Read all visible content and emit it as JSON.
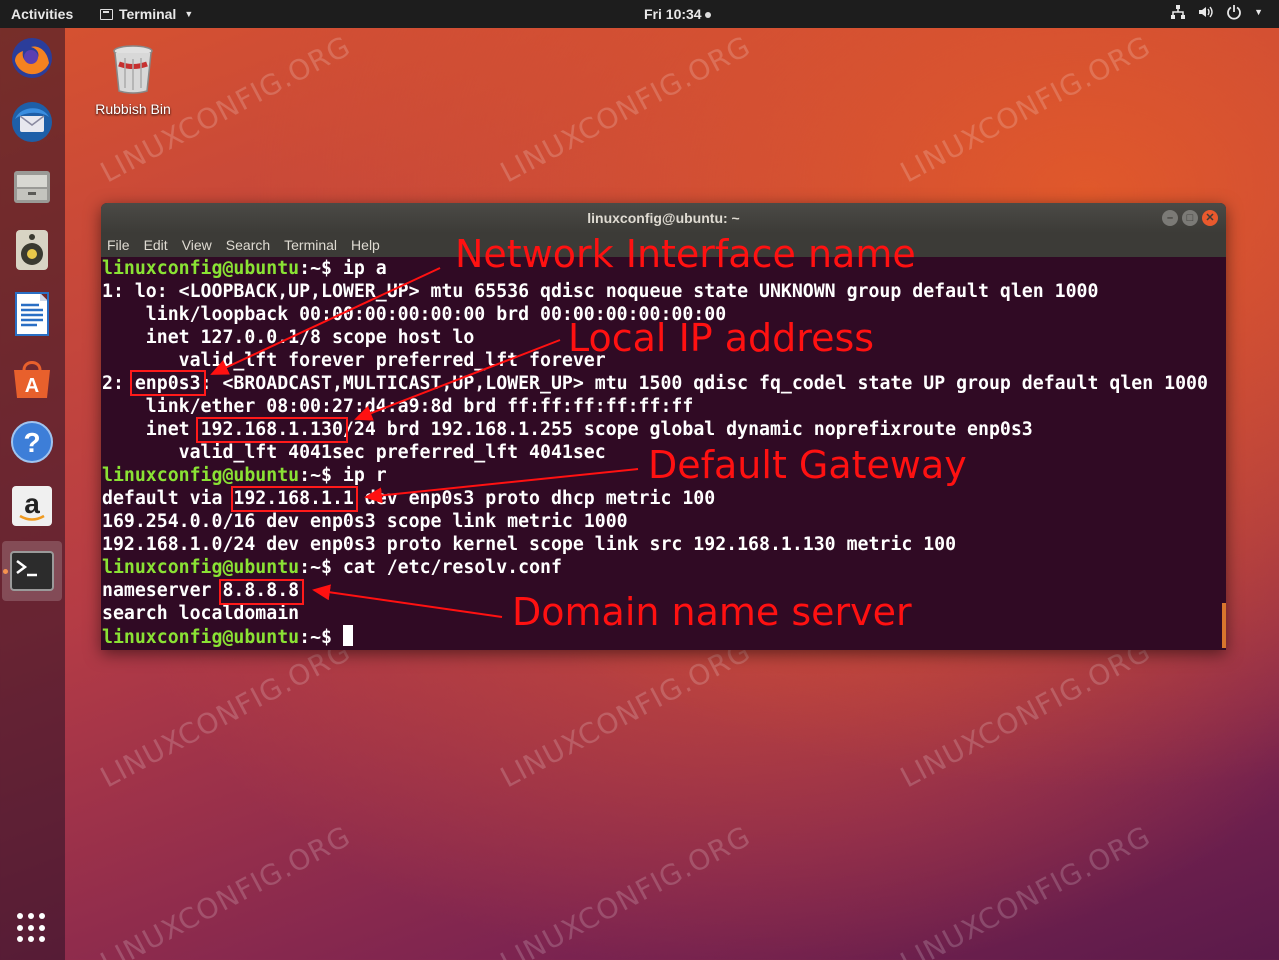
{
  "topbar": {
    "activities": "Activities",
    "app_menu": "Terminal",
    "clock": "Fri 10:34"
  },
  "desktop": {
    "trash_label": "Rubbish Bin",
    "watermark": "LINUXCONFIG.ORG"
  },
  "dock": {
    "items": [
      "firefox-icon",
      "thunderbird-icon",
      "files-icon",
      "rhythmbox-icon",
      "writer-icon",
      "software-center-icon",
      "help-icon",
      "amazon-icon",
      "terminal-icon"
    ]
  },
  "terminal": {
    "title": "linuxconfig@ubuntu: ~",
    "menu": [
      "File",
      "Edit",
      "View",
      "Search",
      "Terminal",
      "Help"
    ],
    "prompt_user": "linuxconfig@ubuntu",
    "prompt_suffix": "~$ ",
    "cmd1": "ip a",
    "cmd2": "ip r",
    "cmd3": "cat /etc/resolv.conf",
    "out": {
      "l1": "1: lo: <LOOPBACK,UP,LOWER_UP> mtu 65536 qdisc noqueue state UNKNOWN group default qlen 1000",
      "l2": "    link/loopback 00:00:00:00:00:00 brd 00:00:00:00:00:00",
      "l3": "    inet 127.0.0.1/8 scope host lo",
      "l4": "       valid_lft forever preferred_lft forever",
      "l5a": "2: ",
      "l5b": "enp0s3",
      "l5c": ": <BROADCAST,MULTICAST,UP,LOWER_UP> mtu 1500 qdisc fq_codel state UP group default qlen 1000",
      "l6": "    link/ether 08:00:27:d4:a9:8d brd ff:ff:ff:ff:ff:ff",
      "l7a": "    inet ",
      "l7b": "192.168.1.130",
      "l7c": "/24 brd 192.168.1.255 scope global dynamic noprefixroute enp0s3",
      "l8": "       valid_lft 4041sec preferred_lft 4041sec",
      "r1a": "default via ",
      "r1b": "192.168.1.1",
      "r1c": " dev enp0s3 proto dhcp metric 100",
      "r2": "169.254.0.0/16 dev enp0s3 scope link metric 1000",
      "r3": "192.168.1.0/24 dev enp0s3 proto kernel scope link src 192.168.1.130 metric 100",
      "n1a": "nameserver ",
      "n1b": "8.8.8.8",
      "n2": "search localdomain"
    }
  },
  "annotations": {
    "iface": "Network Interface name",
    "ip": "Local IP address",
    "gw": "Default Gateway",
    "dns": "Domain name server",
    "color": "#ff1111"
  }
}
